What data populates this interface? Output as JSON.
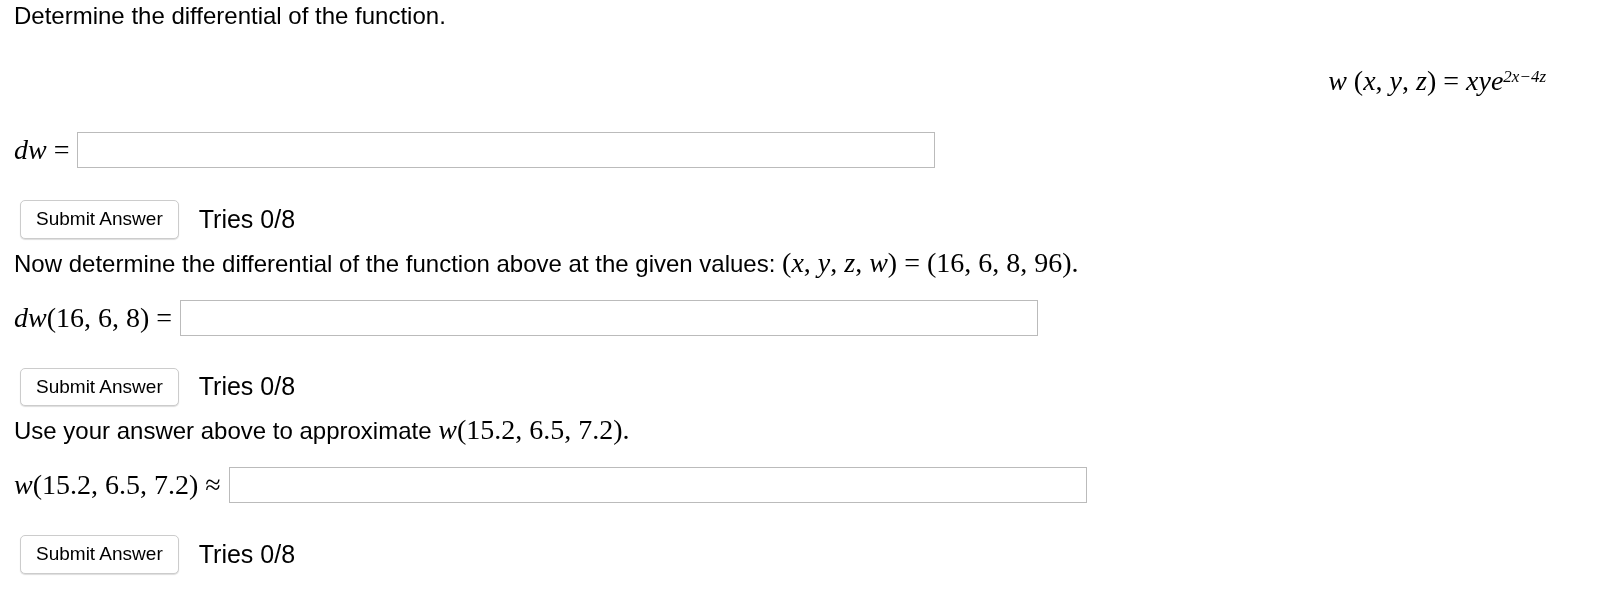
{
  "prompt": "Determine the differential of the function.",
  "formula": "*w* (*x*, *y*, *z*) = *xye*$^{2x−4z}$",
  "parts": [
    {
      "label": "*dw* =",
      "button": "Submit Answer",
      "tries": "Tries 0/8"
    },
    {
      "intro": {
        "text": "Now determine the differential of the function above at the given values:",
        "math": "(*x*, *y*, *z*, *w*) = (16, 6, 8, 96)."
      },
      "label": "*dw*(16, 6, 8) =",
      "button": "Submit Answer",
      "tries": "Tries 0/8"
    },
    {
      "intro": {
        "text": "Use your answer above to approximate",
        "math": "*w*(15.2, 6.5, 7.2)."
      },
      "label": "*w*(15.2, 6.5, 7.2) ≈",
      "button": "Submit Answer",
      "tries": "Tries 0/8"
    }
  ]
}
